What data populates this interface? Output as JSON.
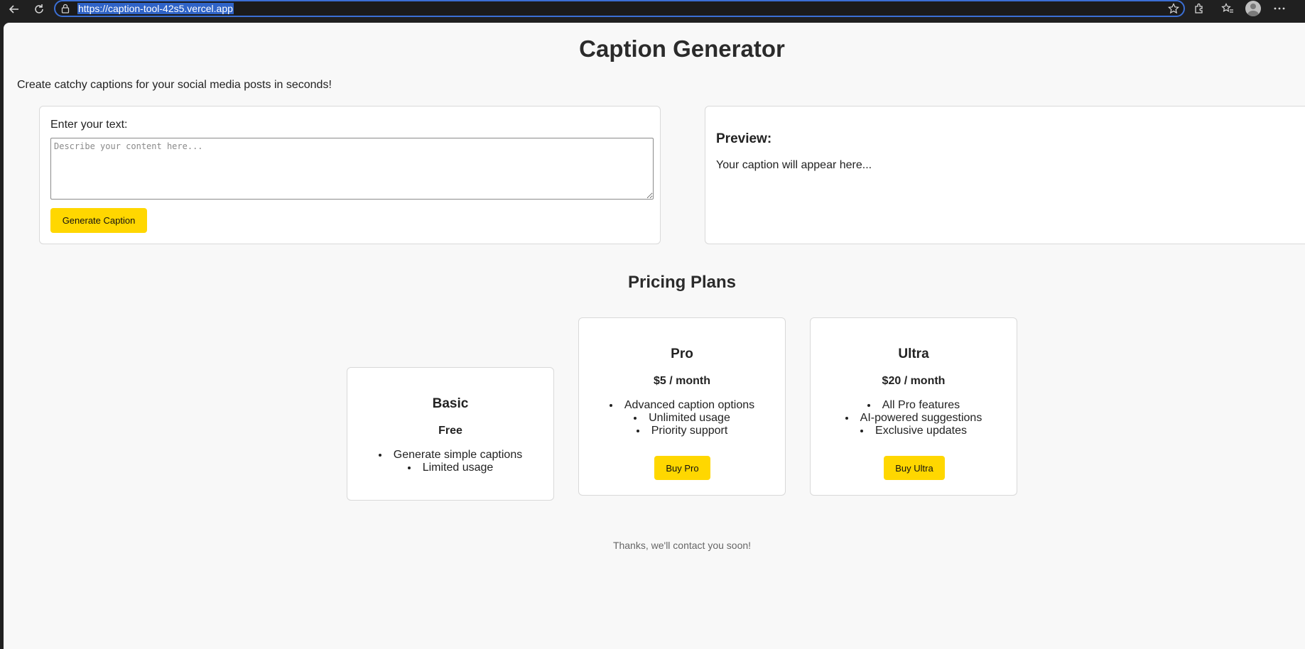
{
  "browser": {
    "url": "https://caption-tool-42s5.vercel.app",
    "icons": [
      "back-arrow-icon",
      "refresh-icon",
      "lock-icon",
      "star-icon",
      "extensions-icon",
      "favorites-icon",
      "profile-avatar",
      "more-options-icon"
    ],
    "accent_color": "#3b6fd4"
  },
  "page": {
    "title": "Caption Generator",
    "tagline": "Create catchy captions for your social media posts in seconds!",
    "input": {
      "label": "Enter your text:",
      "placeholder": "Describe your content here...",
      "value": ""
    },
    "generate_button": "Generate Caption",
    "preview": {
      "heading": "Preview:",
      "text": "Your caption will appear here..."
    },
    "pricing": {
      "heading": "Pricing Plans",
      "plans": [
        {
          "name": "Basic",
          "price": "Free",
          "features": [
            "Generate simple captions",
            "Limited usage"
          ]
        },
        {
          "name": "Pro",
          "price": "$5 / month",
          "features": [
            "Advanced caption options",
            "Unlimited usage",
            "Priority support"
          ],
          "button": "Buy Pro"
        },
        {
          "name": "Ultra",
          "price": "$20 / month",
          "features": [
            "All Pro features",
            "AI-powered suggestions",
            "Exclusive updates"
          ],
          "button": "Buy Ultra"
        }
      ]
    },
    "footer_message": "Thanks, we'll contact you soon!",
    "button_color": "#ffd700"
  }
}
